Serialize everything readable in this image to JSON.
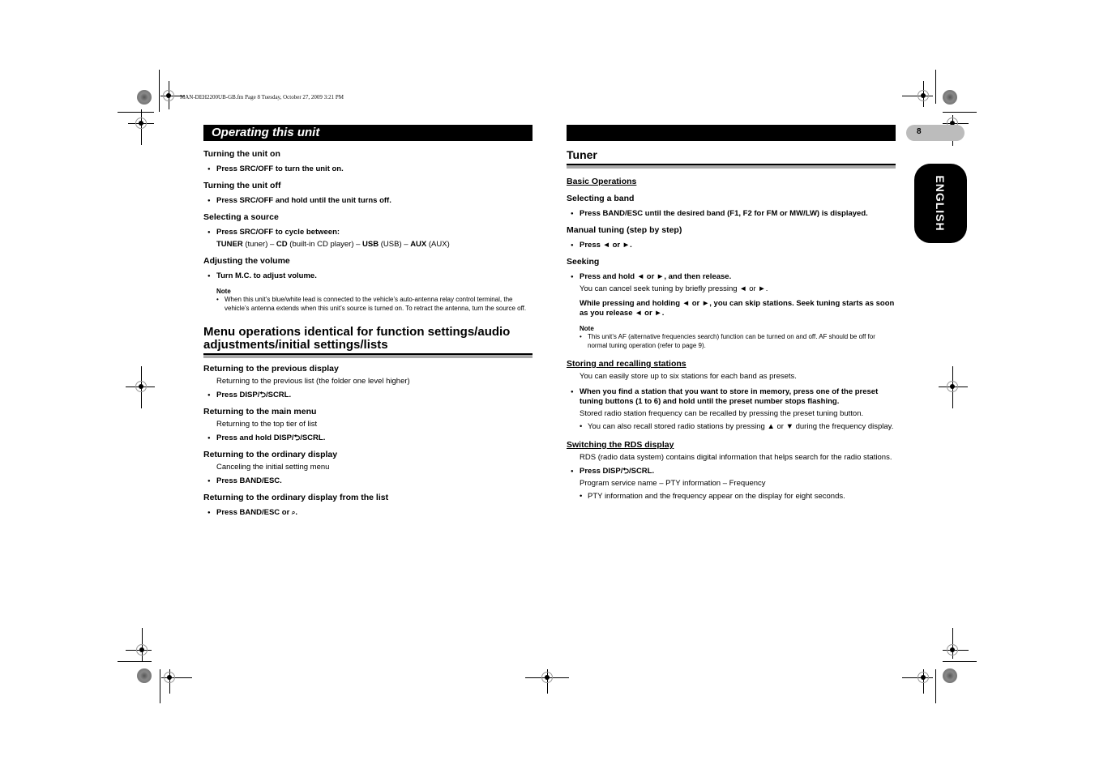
{
  "file_header": "MAN-DEH2200UB-GB.fm  Page 8  Tuesday, October 27, 2009  3:21 PM",
  "page_number": "8",
  "language_tab": "ENGLISH",
  "left": {
    "title": "Operating this unit",
    "sections": [
      {
        "heading": "Turning the unit on",
        "bullet": "Press SRC/OFF to turn the unit on."
      },
      {
        "heading": "Turning the unit off",
        "bullet": "Press SRC/OFF and hold until the unit turns off."
      },
      {
        "heading": "Selecting a source",
        "bullet": "Press SRC/OFF to cycle between:",
        "sources": [
          {
            "name": "TUNER",
            "desc": "(tuner)"
          },
          {
            "name": "CD",
            "desc": "(built-in CD player)"
          },
          {
            "name": "USB",
            "desc": "(USB)"
          },
          {
            "name": "AUX",
            "desc": "(AUX)"
          }
        ],
        "sep": " – "
      },
      {
        "heading": "Adjusting the volume",
        "bullet": "Turn M.C. to adjust volume.",
        "note_label": "Note",
        "note": "When this unit’s blue/white lead is connected to the vehicle’s auto-antenna relay control terminal, the vehicle’s antenna extends when this unit’s source is turned on. To retract the antenna, turn the source off."
      }
    ],
    "menu_heading": "Menu operations identical for function settings/audio adjustments/initial settings/lists",
    "menu_sections": [
      {
        "heading": "Returning to the previous display",
        "desc": "Returning to the previous list (the folder one level higher)",
        "bullet_pre": "Press DISP/",
        "bullet_post": "/SCRL."
      },
      {
        "heading": "Returning to the main menu",
        "desc": "Returning to the top tier of list",
        "bullet_pre": "Press and hold DISP/",
        "bullet_post": "/SCRL."
      },
      {
        "heading": "Returning to the ordinary display",
        "desc": "Canceling the initial setting menu",
        "bullet": "Press BAND/ESC."
      },
      {
        "heading": "Returning to the ordinary display from the list",
        "bullet_pre": "Press BAND/ESC or ",
        "bullet_post": "."
      }
    ]
  },
  "right": {
    "title": "Tuner",
    "basic_ops": "Basic Operations",
    "select_band": {
      "heading": "Selecting a band",
      "bullet": "Press BAND/ESC until the desired band (F1, F2 for FM or MW/LW) is displayed."
    },
    "manual_tuning": {
      "heading": "Manual tuning (step by step)",
      "bullet": "Press ◄ or ►."
    },
    "seeking": {
      "heading": "Seeking",
      "bullet": "Press and hold ◄ or ►, and then release.",
      "desc": "You can cancel seek tuning by briefly pressing ◄ or ►.",
      "bold_desc": "While pressing and holding ◄ or ►, you can skip stations. Seek tuning starts as soon as you release ◄ or ►.",
      "note_label": "Note",
      "note": "This unit’s AF (alternative frequencies search) function can be turned on and off. AF should be off for normal tuning operation (refer to page 9)."
    },
    "storing": {
      "heading": "Storing and recalling stations",
      "desc": "You can easily store up to six stations for each band as presets.",
      "bullet": "When you find a station that you want to store in memory, press one of the preset tuning buttons (1 to 6) and hold until the preset number stops flashing.",
      "desc2": "Stored radio station frequency can be recalled by pressing the preset tuning button.",
      "sub": "You can also recall stored radio stations by pressing ▲ or ▼ during the frequency display."
    },
    "rds": {
      "heading": "Switching the RDS display",
      "desc": "RDS (radio data system) contains digital information that helps search for the radio stations.",
      "bullet_pre": "Press DISP/",
      "bullet_post": "/SCRL.",
      "desc2": "Program service name – PTY information – Frequency",
      "sub": "PTY information and the frequency appear on the display for eight seconds."
    }
  }
}
